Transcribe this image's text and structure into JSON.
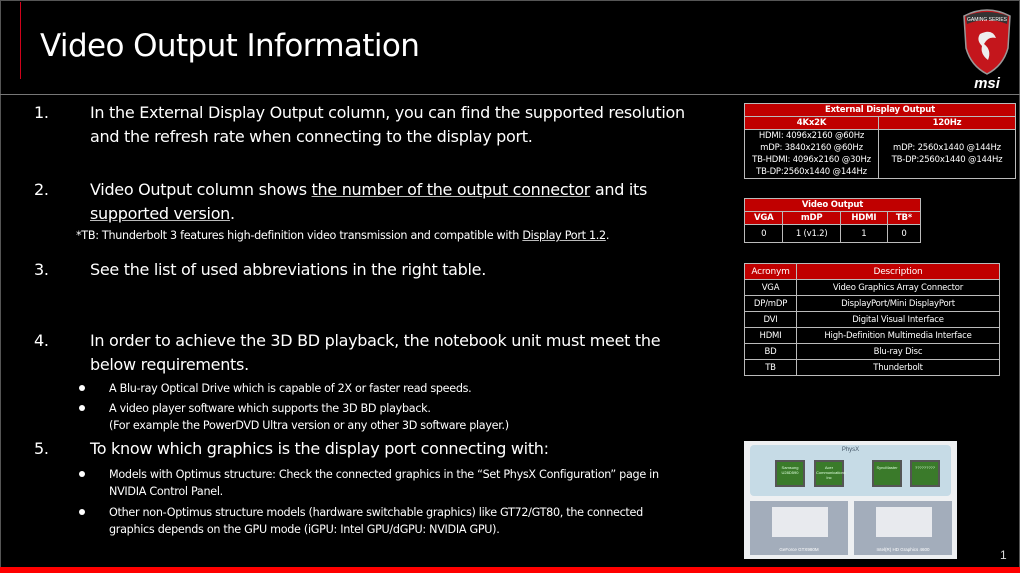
{
  "slide": {
    "title": "Video Output Information",
    "page_number": "1",
    "brand": {
      "logo_label": "msi",
      "badge_text": "GAMING SERIES",
      "accent_color": "#c00000",
      "bar_color": "#ff0000"
    }
  },
  "items": [
    {
      "num": "1.",
      "line1": "In the External Display Output column, you can find the supported resolution",
      "line2": "and the refresh rate when connecting to the display port."
    },
    {
      "num": "2.",
      "line1_pre": "Video Output column shows ",
      "line1_u": "the number of the output connector",
      "line1_post": " and its",
      "line2_u": "supported version",
      "line2_post": "."
    },
    {
      "num": "3.",
      "line1": "See the list of used abbreviations in the right table."
    },
    {
      "num": "4.",
      "line1": "In order to achieve the 3D BD playback, the notebook unit must meet the",
      "line2": "below requirements."
    },
    {
      "num": "5.",
      "line1": "To know which graphics is the display port connecting with:"
    }
  ],
  "note": {
    "pre": "*TB: Thunderbolt 3 features high-definition video transmission and compatible with ",
    "u": "Display Port 1.2",
    "post": "."
  },
  "bullets4": [
    {
      "line1": "A Blu-ray Optical Drive which is capable of 2X or faster read speeds."
    },
    {
      "line1": "A video player software which supports the 3D BD playback.",
      "line2": "(For example the PowerDVD Ultra version or any other 3D software player.)"
    }
  ],
  "bullets5": [
    {
      "line1": "Models with Optimus structure: Check the connected graphics in the “Set PhysX Configuration” page in",
      "line2": "NVIDIA Control Panel."
    },
    {
      "line1": "Other non-Optimus structure models (hardware switchable graphics) like GT72/GT80, the connected",
      "line2": "graphics depends on the GPU mode (iGPU: Intel GPU/dGPU: NVIDIA GPU)."
    }
  ],
  "external_display_output": {
    "title": "External Display Output",
    "headers": [
      "4Kx2K",
      "120Hz"
    ],
    "col1": [
      "HDMI: 4096x2160 @60Hz",
      "mDP: 3840x2160 @60Hz",
      "TB-HDMI: 4096x2160  @30Hz",
      "TB-DP:2560x1440 @144Hz"
    ],
    "col2": [
      "mDP: 2560x1440 @144Hz",
      "TB-DP:2560x1440 @144Hz"
    ]
  },
  "video_output": {
    "title": "Video Output",
    "headers": [
      "VGA",
      "mDP",
      "HDMI",
      "TB*"
    ],
    "values": [
      "0",
      "1 (v1.2)",
      "1",
      "0"
    ]
  },
  "acronyms": {
    "headers": [
      "Acronym",
      "Description"
    ],
    "rows": [
      [
        "VGA",
        "Video Graphics Array Connector"
      ],
      [
        "DP/mDP",
        "DisplayPort/Mini DisplayPort"
      ],
      [
        "DVI",
        "Digital Visual Interface"
      ],
      [
        "HDMI",
        "High-Definition Multimedia Interface"
      ],
      [
        "BD",
        "Blu-ray Disc"
      ],
      [
        "TB",
        "Thunderbolt"
      ]
    ]
  },
  "physx_image": {
    "panel_label": "PhysX",
    "monitors": [
      "Samsung U28D590",
      "Acer Communications Inc",
      "SyncMaster",
      "?????????"
    ],
    "gpus": [
      "GeForce GTX980M",
      "Intel(R) HD Graphics 4600"
    ]
  }
}
